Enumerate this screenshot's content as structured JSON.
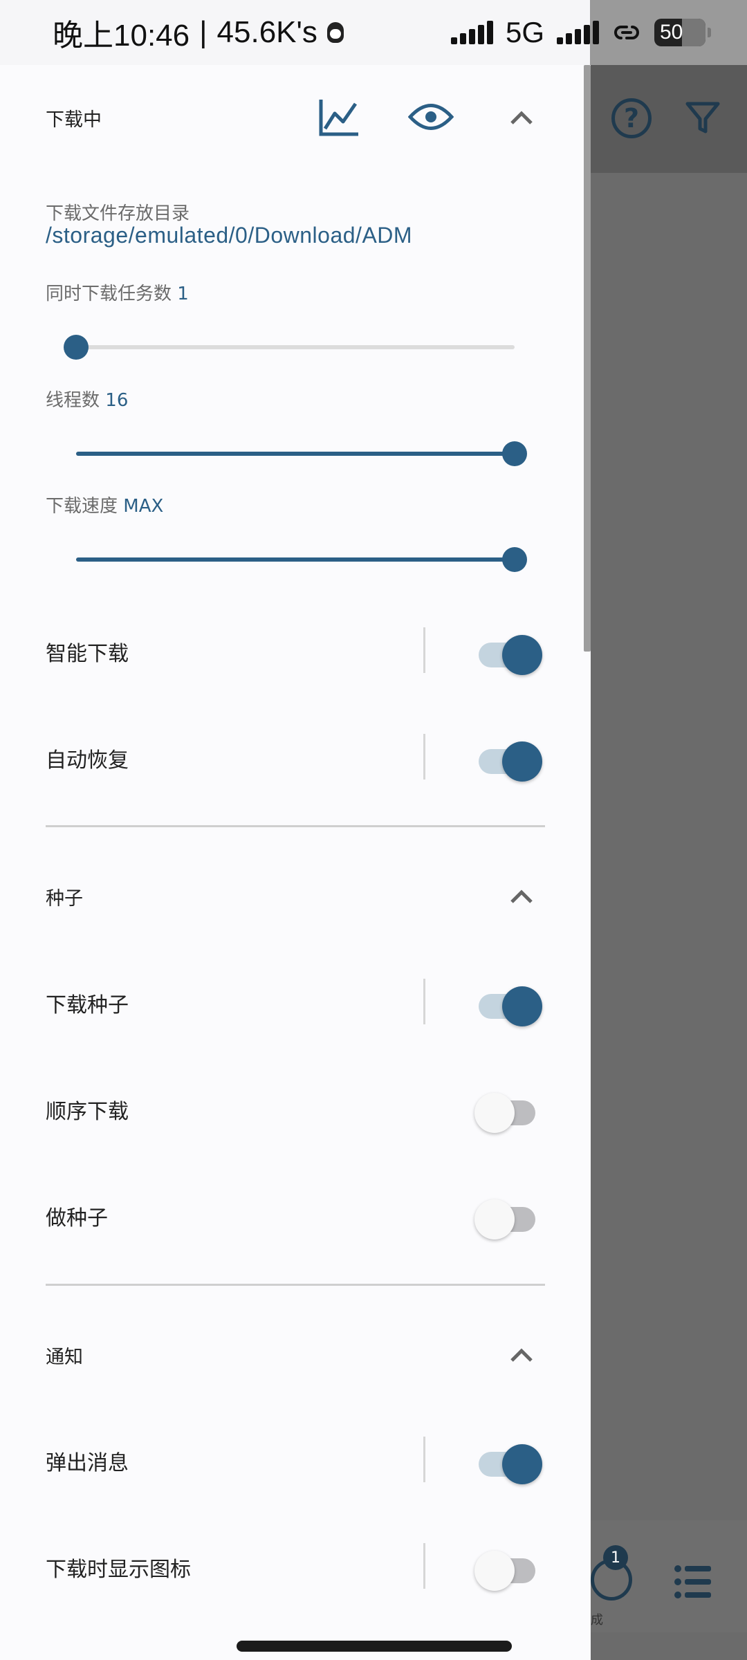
{
  "status_bar": {
    "time": "晚上10:46",
    "separator": "|",
    "net_speed": "45.6K's",
    "network": "5G",
    "battery": "50"
  },
  "drawer": {
    "downloading": {
      "title": "下载中",
      "directory_label": "下载文件存放目录",
      "directory_path": "/storage/emulated/0/Download/ADM",
      "concurrent_label": "同时下载任务数",
      "concurrent_value": "1",
      "concurrent_fraction": 0,
      "threads_label": "线程数",
      "threads_value": "16",
      "threads_fraction": 1,
      "speed_label": "下载速度",
      "speed_value": "MAX",
      "speed_fraction": 1,
      "smart_download": {
        "label": "智能下载",
        "on": true
      },
      "auto_resume": {
        "label": "自动恢复",
        "on": true
      }
    },
    "torrent": {
      "title": "种子",
      "download_torrent": {
        "label": "下载种子",
        "on": true
      },
      "sequential": {
        "label": "顺序下载",
        "on": false
      },
      "seeding": {
        "label": "做种子",
        "on": false
      }
    },
    "notification": {
      "title": "通知",
      "popup": {
        "label": "弹出消息",
        "on": true
      },
      "show_icon": {
        "label": "下载时显示图标",
        "on": false
      }
    }
  },
  "background": {
    "done_badge": "1",
    "done_label": "成"
  },
  "colors": {
    "accent": "#2b5f86",
    "track_on": "#c4d4df",
    "track_off": "#bdbdc0"
  }
}
